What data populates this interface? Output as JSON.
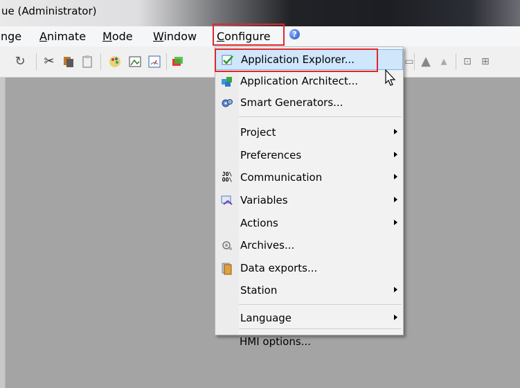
{
  "window": {
    "title": "ue (Administrator)"
  },
  "menubar": {
    "items": [
      {
        "label": "nge",
        "prefix": "",
        "key": "",
        "rest": "nge"
      },
      {
        "label": "Animate",
        "prefix": "",
        "key": "A",
        "rest": "nimate"
      },
      {
        "label": "Mode",
        "prefix": "",
        "key": "M",
        "rest": "ode"
      },
      {
        "label": "Window",
        "prefix": "",
        "key": "W",
        "rest": "indow"
      },
      {
        "label": "Configure",
        "prefix": "",
        "key": "C",
        "rest": "onfigure"
      }
    ],
    "help_icon": "?"
  },
  "toolbar": {
    "icons": [
      "redo-icon",
      "cut-icon",
      "copy-icon",
      "paste-icon",
      "palette-icon",
      "bitmap-icon",
      "gauge-icon",
      "layers-icon"
    ]
  },
  "configure_menu": {
    "items": [
      {
        "label": "Application Explorer...",
        "icon": "application-explorer-icon",
        "submenu": false
      },
      {
        "label": "Application Architect...",
        "icon": "application-architect-icon",
        "submenu": false
      },
      {
        "label": "Smart Generators...",
        "icon": "smart-generators-icon",
        "submenu": false
      },
      {
        "label": "Project",
        "icon": "",
        "submenu": true
      },
      {
        "label": "Preferences",
        "icon": "",
        "submenu": true
      },
      {
        "label": "Communication",
        "icon": "communication-icon",
        "submenu": true
      },
      {
        "label": "Variables",
        "icon": "variables-icon",
        "submenu": true
      },
      {
        "label": "Actions",
        "icon": "",
        "submenu": true
      },
      {
        "label": "Archives...",
        "icon": "archives-icon",
        "submenu": false
      },
      {
        "label": "Data exports...",
        "icon": "data-exports-icon",
        "submenu": false
      },
      {
        "label": "Station",
        "icon": "",
        "submenu": true
      },
      {
        "label": "Language",
        "icon": "",
        "submenu": true
      },
      {
        "label": "HMI options...",
        "icon": "",
        "submenu": false
      }
    ]
  },
  "colors": {
    "highlight_border": "#e0262b",
    "selected_bg": "#cfe6fb",
    "workspace_bg": "#a4a4a4"
  }
}
